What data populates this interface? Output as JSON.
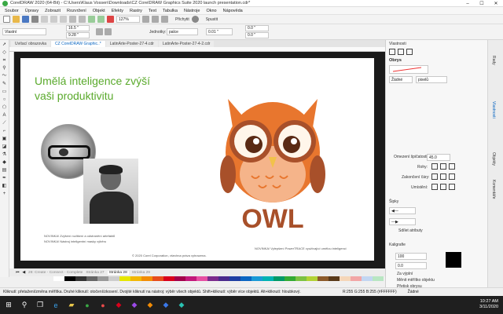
{
  "window": {
    "title": "CorelDRAW 2020 (64-Bit) - C:\\Users\\Klaus Vossen\\Downloads\\CZ CorelDRAW Graphics Suite 2020 launch presentation.cdr*"
  },
  "menu": [
    "Soubor",
    "Úpravy",
    "Zobrazit",
    "Rozvržení",
    "Objekt",
    "Efekty",
    "Rastry",
    "Text",
    "Tabulka",
    "Nástroje",
    "Okno",
    "Nápověda"
  ],
  "toolbar": {
    "zoom": "127%",
    "snap_label": "Přichytit",
    "launch_label": "Spustit"
  },
  "propbar": {
    "preset": "Vlastní",
    "width": "16.5 \"",
    "height": "9.28 \"",
    "units_label": "Jednotky:",
    "units_value": "palce",
    "nudge": "0.01 \"",
    "dup_x": "0.0 \"",
    "dup_y": "0.0 \""
  },
  "tabs": [
    {
      "label": "Uvítací obrazovka"
    },
    {
      "label": "CZ CorelDRAW Graphic..*"
    },
    {
      "label": "LatinArte-Poster-27-4.cdr"
    },
    {
      "label": "LatinArte-Poster-27-4-2.cdr"
    }
  ],
  "slide": {
    "headline_line1": "Umělá inteligence zvýší",
    "headline_line2": "vaši produktivitu",
    "caption_left_1": "NOVINKA! Zvýšení rozlišení a odstranění artefaktů",
    "caption_left_2": "NOVINKA! Nástroj inteligentní masky výběru",
    "caption_right": "NOVINKA! Vylepšení PowerTRACE využívající umělou inteligenci",
    "footer": "© 2020 Corel Corporation, všechna práva vyhrazena.",
    "owl_text": "OWL"
  },
  "pagenav": {
    "pages": [
      "28: Create - Connect - Complete",
      "Stránka 27",
      "Stránka 28",
      "Stránka 29"
    ]
  },
  "colors": {
    "owl_orange": "#e8762e",
    "owl_light": "#f5b48a",
    "owl_brown": "#a8502a",
    "headline_green": "#5aaa2c",
    "accent_blue": "#0a66c2"
  },
  "dock": {
    "header": "Vlastnosti",
    "section_outline": "Obrys",
    "outline_none": "Žádné",
    "outline_unit": "pixelů",
    "miter_label": "Omezení špičatosti:",
    "miter_value": "45.0",
    "corners_label": "Rohy:",
    "caps_label": "Zakončení čáry:",
    "position_label": "Umístění:",
    "arrows_label": "Šipky",
    "share_attrs": "Sdílet atributy",
    "calligraphy_label": "Kaligrafie",
    "cal_value1": "100",
    "cal_value2": "0.0",
    "behind_fill": "Za výplní",
    "scale_with": "Měnit měřítko objektu",
    "overprint": "Přetisk obrysu"
  },
  "vtabs": [
    "Rady",
    "Vlastnosti",
    "Objekty",
    "Komentáře"
  ],
  "status": {
    "hint": "Kliknutí: přetažení/změna měřítka. Druhé kliknutí: otočení/zkosení. Dvojité kliknutí na nástroj: výběr všech objektů. Shift+kliknutí: výběr více objektů. Alt+kliknutí: hloubkový.",
    "color_readout": "R:255 G:255 B:255 (#FFFFFF)",
    "fill_none": "Žádné"
  },
  "taskbar": {
    "time": "10:27 AM",
    "date": "3/11/2020"
  }
}
